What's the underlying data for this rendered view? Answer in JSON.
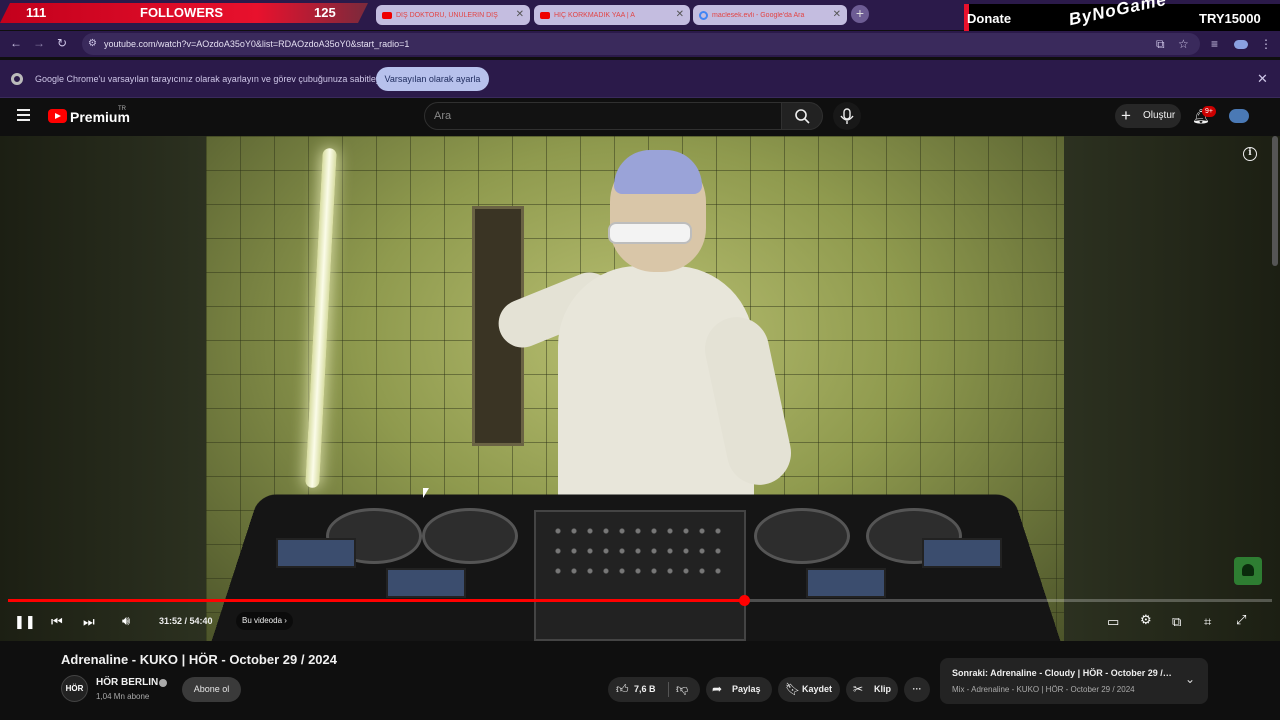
{
  "overlay": {
    "follower_count": "111",
    "follower_label": "FOLLOWERS",
    "follower_goal": "125",
    "donate_label": "Donate",
    "donate_goal": "TRY15000",
    "brand": "ByNoGame"
  },
  "tabs": [
    {
      "title": "DİŞ DOKTORU, ÜNÜLERİN DİŞ",
      "icon": "youtube-icon"
    },
    {
      "title": "HİÇ KORKMADIK YAA | A",
      "icon": "youtube-icon"
    },
    {
      "title": "maclesek.evli - Google'da Ara",
      "icon": "google-icon"
    }
  ],
  "address_bar": {
    "url": "youtube.com/watch?v=AOzdoA35oY0&list=RDAOzdoA35oY0&start_radio=1"
  },
  "infobar": {
    "message": "Google Chrome'u varsayılan tarayıcınız olarak ayarlayın ve görev çubuğunuza sabitleyin",
    "button_label": "Varsayılan olarak ayarla"
  },
  "masthead": {
    "brand": "Premium",
    "region": "TR",
    "search_placeholder": "Ara",
    "create_label": "Oluştur",
    "notifications_badge": "9+"
  },
  "player": {
    "progress_fraction": 0.582,
    "time_display": "31:52 / 54:40",
    "chapter_label": "Bu videoda"
  },
  "video": {
    "title": "Adrenaline - KUKO | HÖR - October 29 / 2024",
    "channel_name": "HÖR BERLIN",
    "channel_avatar_text": "HÖR",
    "subscribers": "1,04 Mn abone",
    "subscribe_label": "Abone ol",
    "likes": "7,6 B",
    "share_label": "Paylaş",
    "save_label": "Kaydet",
    "clip_label": "Klip",
    "more_label": "···"
  },
  "next_up": {
    "title": "Sonraki: Adrenaline - Cloudy | HÖR - October 29 / 2...",
    "subtitle": "Mix - Adrenaline - KUKO | HÖR - October 29 / 2024"
  },
  "colors": {
    "accent": "#ff0000",
    "browser_frame": "#2b1a4a",
    "overlay_red": "#e8112d"
  }
}
